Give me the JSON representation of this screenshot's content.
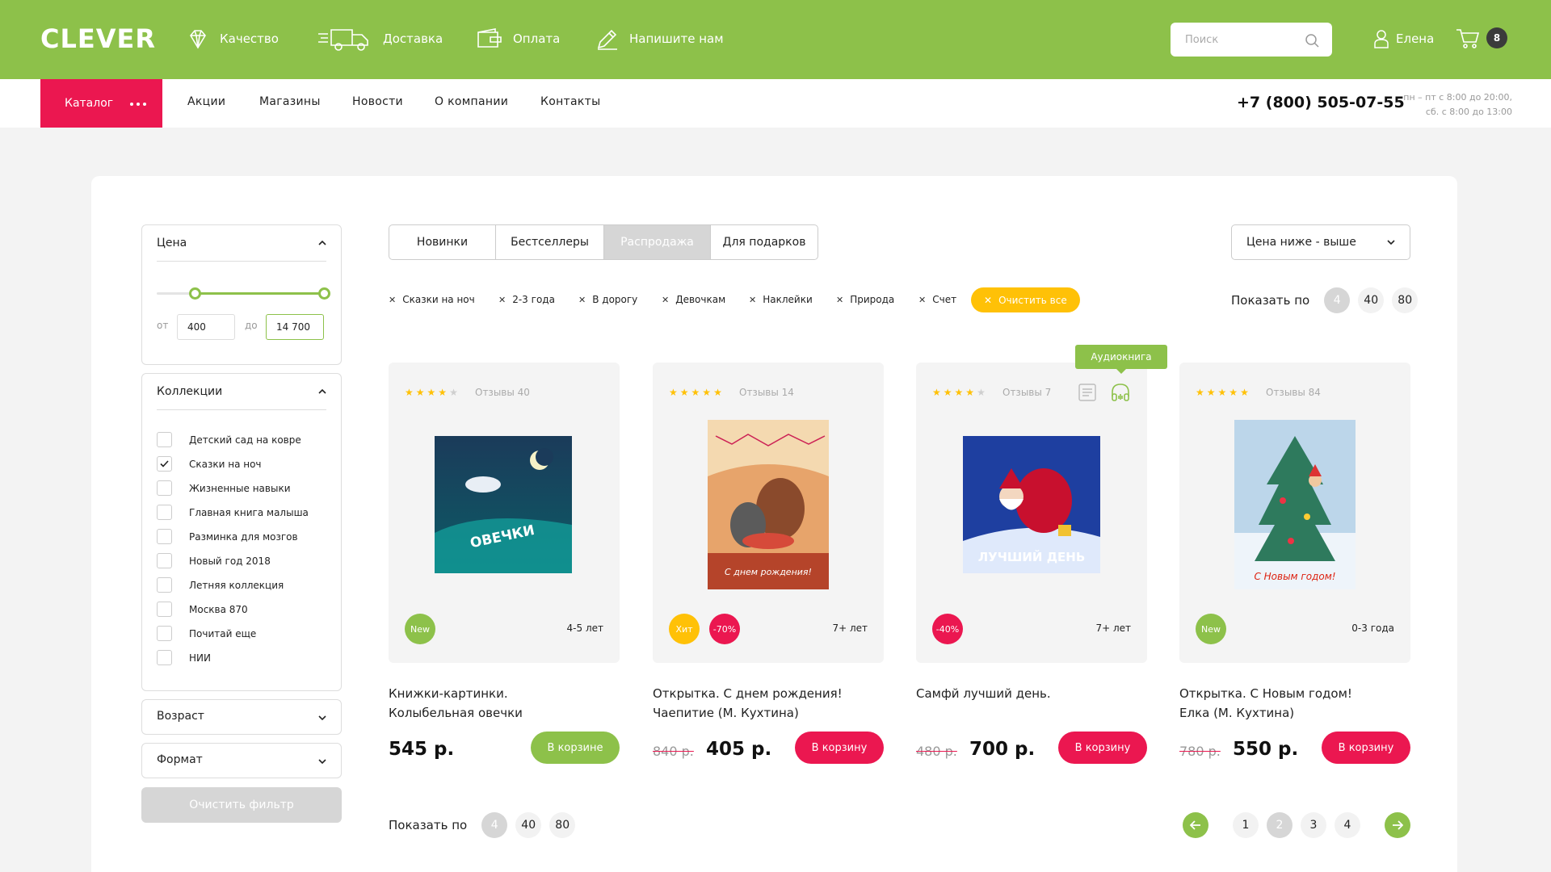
{
  "header": {
    "logo": "CLEVER",
    "nav": [
      {
        "label": "Качество",
        "icon": "diamond-icon"
      },
      {
        "label": "Доставка",
        "icon": "truck-icon"
      },
      {
        "label": "Оплата",
        "icon": "wallet-icon"
      },
      {
        "label": "Напишите нам",
        "icon": "pencil-icon"
      }
    ],
    "search_placeholder": "Поиск",
    "user_name": "Елена",
    "cart_count": "8",
    "accent_green": "#8dc14a",
    "accent_red": "#eb1750",
    "accent_yellow": "#ffc107"
  },
  "nav2": {
    "catalog": "Каталог",
    "links": [
      "Акции",
      "Магазины",
      "Новости",
      "О компании",
      "Контакты"
    ],
    "phone": "+7 (800) 505-07-55",
    "hours_line1": "пн – пт с 8:00 до 20:00,",
    "hours_line2": "сб. с 8:00 до 13:00"
  },
  "filters": {
    "price": {
      "title": "Цена",
      "from_label": "от",
      "to_label": "до",
      "from_value": "400",
      "to_value": "14 700"
    },
    "collections": {
      "title": "Коллекции",
      "items": [
        {
          "label": "Детский сад на ковре",
          "checked": false
        },
        {
          "label": "Сказки на ноч",
          "checked": true
        },
        {
          "label": "Жизненные навыки",
          "checked": false
        },
        {
          "label": "Главная книга малыша",
          "checked": false
        },
        {
          "label": "Разминка для мозгов",
          "checked": false
        },
        {
          "label": "Новый год 2018",
          "checked": false
        },
        {
          "label": "Летняя коллекция",
          "checked": false
        },
        {
          "label": "Москва 870",
          "checked": false
        },
        {
          "label": "Почитай еще",
          "checked": false
        },
        {
          "label": "НИИ",
          "checked": false
        }
      ]
    },
    "age_title": "Возраст",
    "format_title": "Формат",
    "clear_button": "Очистить фильтр"
  },
  "tabs": [
    {
      "label": "Новинки",
      "active": false
    },
    {
      "label": "Бестселлеры",
      "active": false
    },
    {
      "label": "Распродажа",
      "active": true
    },
    {
      "label": "Для подарков",
      "active": false
    }
  ],
  "sort": {
    "selected": "Цена ниже - выше"
  },
  "chips": [
    "Сказки на ноч",
    "2-3 года",
    "В дорогу",
    "Девочкам",
    "Наклейки",
    "Природа",
    "Счет"
  ],
  "clear_all": "Очистить все",
  "show_by": {
    "label": "Показать по",
    "options": [
      "4",
      "40",
      "80"
    ],
    "selected": "4"
  },
  "audio_tooltip": "Аудиокнига",
  "products": [
    {
      "rating": 4,
      "reviews": "Отзывы 40",
      "badges": [
        {
          "text": "New",
          "color": "#8dc14a"
        }
      ],
      "age": "4-5 лет",
      "title_line1": "Книжки-картинки.",
      "title_line2": "Колыбельная овечки",
      "old_price": "",
      "price": "545 р.",
      "button": "В корзине",
      "in_cart": true,
      "cover_text": "Колыбельная овечки"
    },
    {
      "rating": 5,
      "reviews": "Отзывы 14",
      "badges": [
        {
          "text": "Хит",
          "color": "#ffc107"
        },
        {
          "text": "-70%",
          "color": "#eb1750"
        }
      ],
      "age": "7+ лет",
      "title_line1": "Открытка. С днем рождения!",
      "title_line2": "Чаепитие (М. Кухтина)",
      "old_price": "840 р.",
      "price": "405 р.",
      "button": "В корзину",
      "in_cart": false,
      "cover_text": "С днем рождения!"
    },
    {
      "rating": 4,
      "reviews": "Отзывы 7",
      "badges": [
        {
          "text": "-40%",
          "color": "#eb1750"
        }
      ],
      "age": "7+ лет",
      "title_line1": "Самфй лучший день.",
      "title_line2": "",
      "old_price": "480 р.",
      "price": "700 р.",
      "button": "В корзину",
      "in_cart": false,
      "cover_text": "Самый лучший день"
    },
    {
      "rating": 5,
      "reviews": "Отзывы 84",
      "badges": [
        {
          "text": "New",
          "color": "#8dc14a"
        }
      ],
      "age": "0-3 года",
      "title_line1": "Открытка. С Новым годом!",
      "title_line2": "Елка (М. Кухтина)",
      "old_price": "780 р.",
      "price": "550 р.",
      "button": "В корзину",
      "in_cart": false,
      "cover_text": "С Новым годом!"
    }
  ],
  "pagination": {
    "pages": [
      "1",
      "2",
      "3",
      "4"
    ],
    "current": "2"
  }
}
